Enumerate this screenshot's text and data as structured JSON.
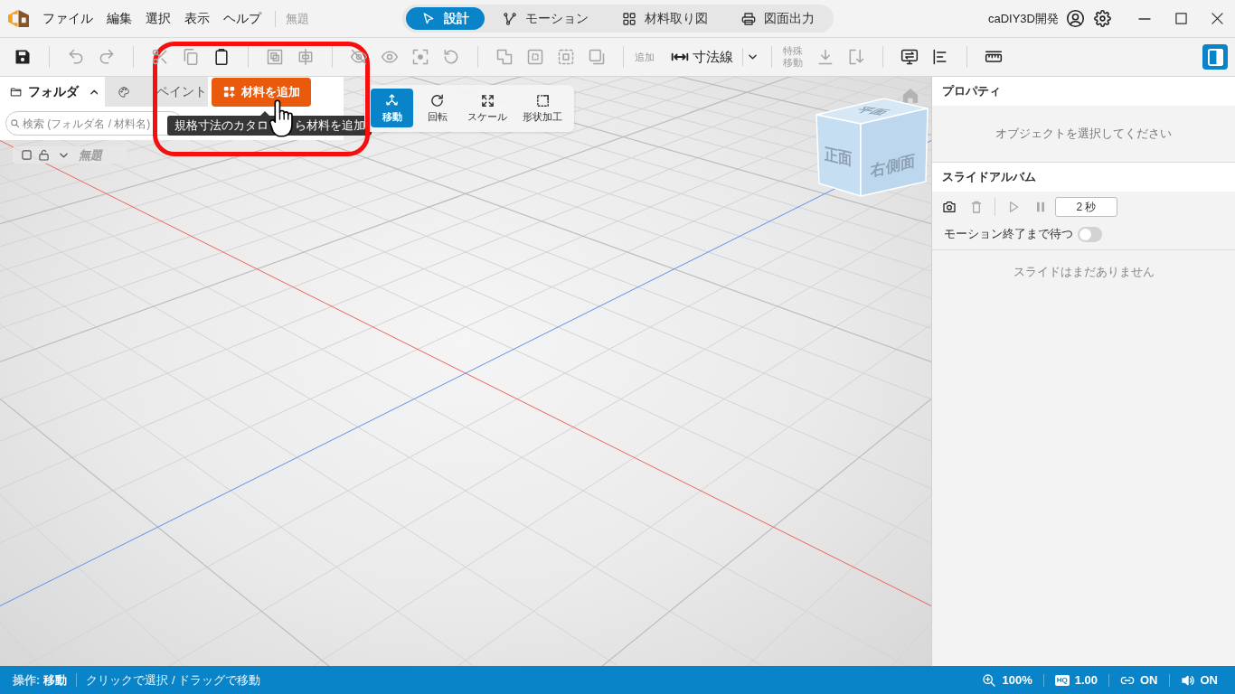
{
  "app_bar": {
    "menu": [
      "ファイル",
      "編集",
      "選択",
      "表示",
      "ヘルプ"
    ],
    "document_title": "無題",
    "mode_tabs": [
      {
        "label": "設計",
        "selected": true
      },
      {
        "label": "モーション",
        "selected": false
      },
      {
        "label": "材料取り図",
        "selected": false
      },
      {
        "label": "図面出力",
        "selected": false
      }
    ],
    "account": "caDIY3D開発"
  },
  "toolbar_groups": [
    [
      {
        "kind": "icon",
        "disabled": false
      }
    ],
    [
      {
        "kind": "icon",
        "disabled": true
      },
      {
        "kind": "icon",
        "disabled": true
      }
    ],
    [
      {
        "kind": "icon",
        "disabled": true
      },
      {
        "kind": "icon",
        "disabled": true
      },
      {
        "kind": "icon",
        "disabled": false
      }
    ],
    [
      {
        "kind": "icon",
        "disabled": true
      },
      {
        "kind": "icon",
        "disabled": true
      }
    ],
    [
      {
        "kind": "icon",
        "disabled": true
      },
      {
        "kind": "icon",
        "disabled": true
      },
      {
        "kind": "icon",
        "disabled": true
      },
      {
        "kind": "icon",
        "disabled": true
      }
    ],
    [
      {
        "kind": "icon",
        "disabled": true
      },
      {
        "kind": "icon",
        "disabled": true
      },
      {
        "kind": "icon",
        "disabled": true
      },
      {
        "kind": "icon",
        "disabled": true
      }
    ],
    [
      {
        "kind": "label",
        "text": "追加"
      },
      {
        "kind": "dropdown",
        "text": "寸法線",
        "disabled": false
      }
    ],
    [
      {
        "kind": "label",
        "text": "特殊移動"
      },
      {
        "kind": "icon",
        "disabled": true
      },
      {
        "kind": "icon",
        "disabled": true
      }
    ],
    [
      {
        "kind": "icon",
        "disabled": false
      },
      {
        "kind": "icon",
        "disabled": false
      }
    ],
    [
      {
        "kind": "icon",
        "disabled": false
      }
    ]
  ],
  "panel_toggle": {
    "on": true
  },
  "left_panel": {
    "tabs": [
      {
        "label": "フォルダ",
        "selected": true,
        "expanded": true
      },
      {
        "label": "ペイント",
        "selected": false
      }
    ],
    "add_button": "材料を追加",
    "tooltip_parts": [
      "規格寸法のカタロ",
      "ら材料を追加"
    ],
    "search": {
      "placeholder": "検索 (フォルダ名 / 材料名)"
    },
    "tree": [
      {
        "label": "無題",
        "checked": false,
        "locked": false
      }
    ]
  },
  "transform_tools": [
    {
      "label": "移動",
      "selected": true
    },
    {
      "label": "回転",
      "selected": false
    },
    {
      "label": "スケール",
      "selected": false
    },
    {
      "label": "形状加工",
      "selected": false
    }
  ],
  "view_cube": {
    "faces": [
      "平面",
      "正面",
      "右側面"
    ]
  },
  "properties": {
    "title": "プロパティ",
    "empty_message": "オブジェクトを選択してください"
  },
  "slide_album": {
    "title": "スライドアルバム",
    "controls": [
      {
        "disabled": false
      },
      {
        "disabled": true
      },
      {
        "disabled": true
      },
      {
        "disabled": true
      }
    ],
    "interval": "2 秒",
    "wait_for_motion": {
      "label": "モーション終了まで待つ",
      "on": false
    },
    "empty_message": "スライドはまだありません"
  },
  "status_bar": {
    "mode_label": "操作:",
    "mode": "移動",
    "hint": "クリックで選択 / ドラッグで移動",
    "indicators": [
      {
        "kind": "zoom",
        "text": "100%"
      },
      {
        "kind": "quality",
        "badge": "HQ",
        "text": "1.00"
      },
      {
        "kind": "link",
        "text": "ON"
      },
      {
        "kind": "sound",
        "text": "ON"
      }
    ]
  }
}
